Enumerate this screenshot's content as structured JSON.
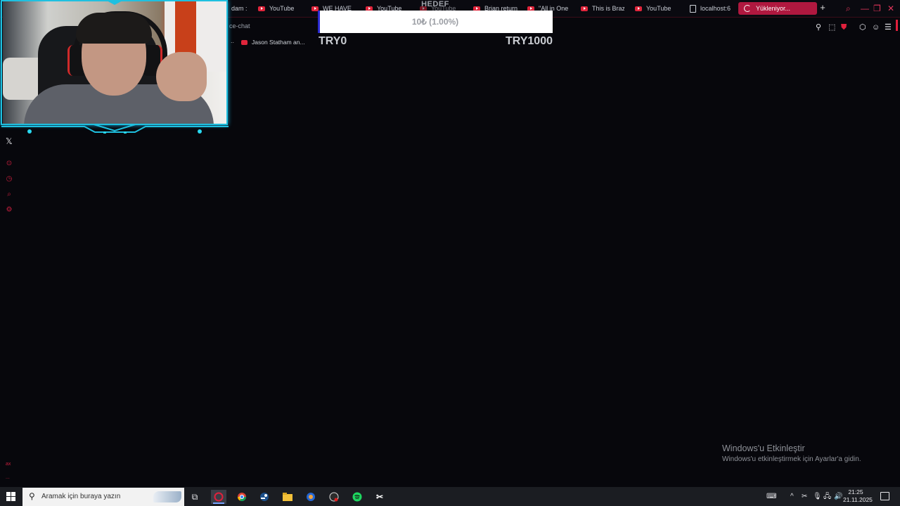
{
  "browser": {
    "tabs": [
      {
        "label": "dam :",
        "icon": "none"
      },
      {
        "label": "YouTube",
        "icon": "youtube-icon"
      },
      {
        "label": "WE HAVE",
        "icon": "youtube-icon"
      },
      {
        "label": "YouTube",
        "icon": "youtube-icon"
      },
      {
        "label": "YouTube",
        "icon": "youtube-icon"
      },
      {
        "label": "Brian return",
        "icon": "youtube-icon"
      },
      {
        "label": "\"All in One",
        "icon": "youtube-icon"
      },
      {
        "label": "This is Braz",
        "icon": "youtube-icon"
      },
      {
        "label": "YouTube",
        "icon": "youtube-icon"
      },
      {
        "label": "localhost:6",
        "icon": "document-icon"
      }
    ],
    "active_tab": {
      "label": "Yükleniyor...",
      "icon": "spinner-icon"
    },
    "new_tab_label": "+",
    "breadcrumb": "ce-chat",
    "bookmark": {
      "label": "Jason Statham an...",
      "icon": "youtube-icon"
    },
    "accent_color": "#b0183f"
  },
  "goal": {
    "title": "HEDEF",
    "progress_text": "10₺ (1.00%)",
    "progress_fraction": 0.01,
    "min_label": "TRY0",
    "max_label": "TRY1000",
    "fill_color": "#2a2ad0"
  },
  "left_rail": {
    "icons": [
      "x-icon",
      "record-icon",
      "clock-icon",
      "chat-icon",
      "settings-icon"
    ],
    "bottom_labels": [
      "ax",
      "..."
    ]
  },
  "watermark": {
    "title": "Windows'u Etkinleştir",
    "subtitle": "Windows'u etkinleştirmek için Ayarlar'a gidin."
  },
  "taskbar": {
    "search_placeholder": "Aramak için buraya yazın",
    "apps": [
      "task-view-icon",
      "opera-gx-icon",
      "chrome-icon",
      "steam-icon",
      "file-explorer-icon",
      "security-icon",
      "obs-icon",
      "spotify-icon",
      "capcut-icon"
    ],
    "clock_time": "21:25",
    "clock_date": "21.11.2025"
  }
}
